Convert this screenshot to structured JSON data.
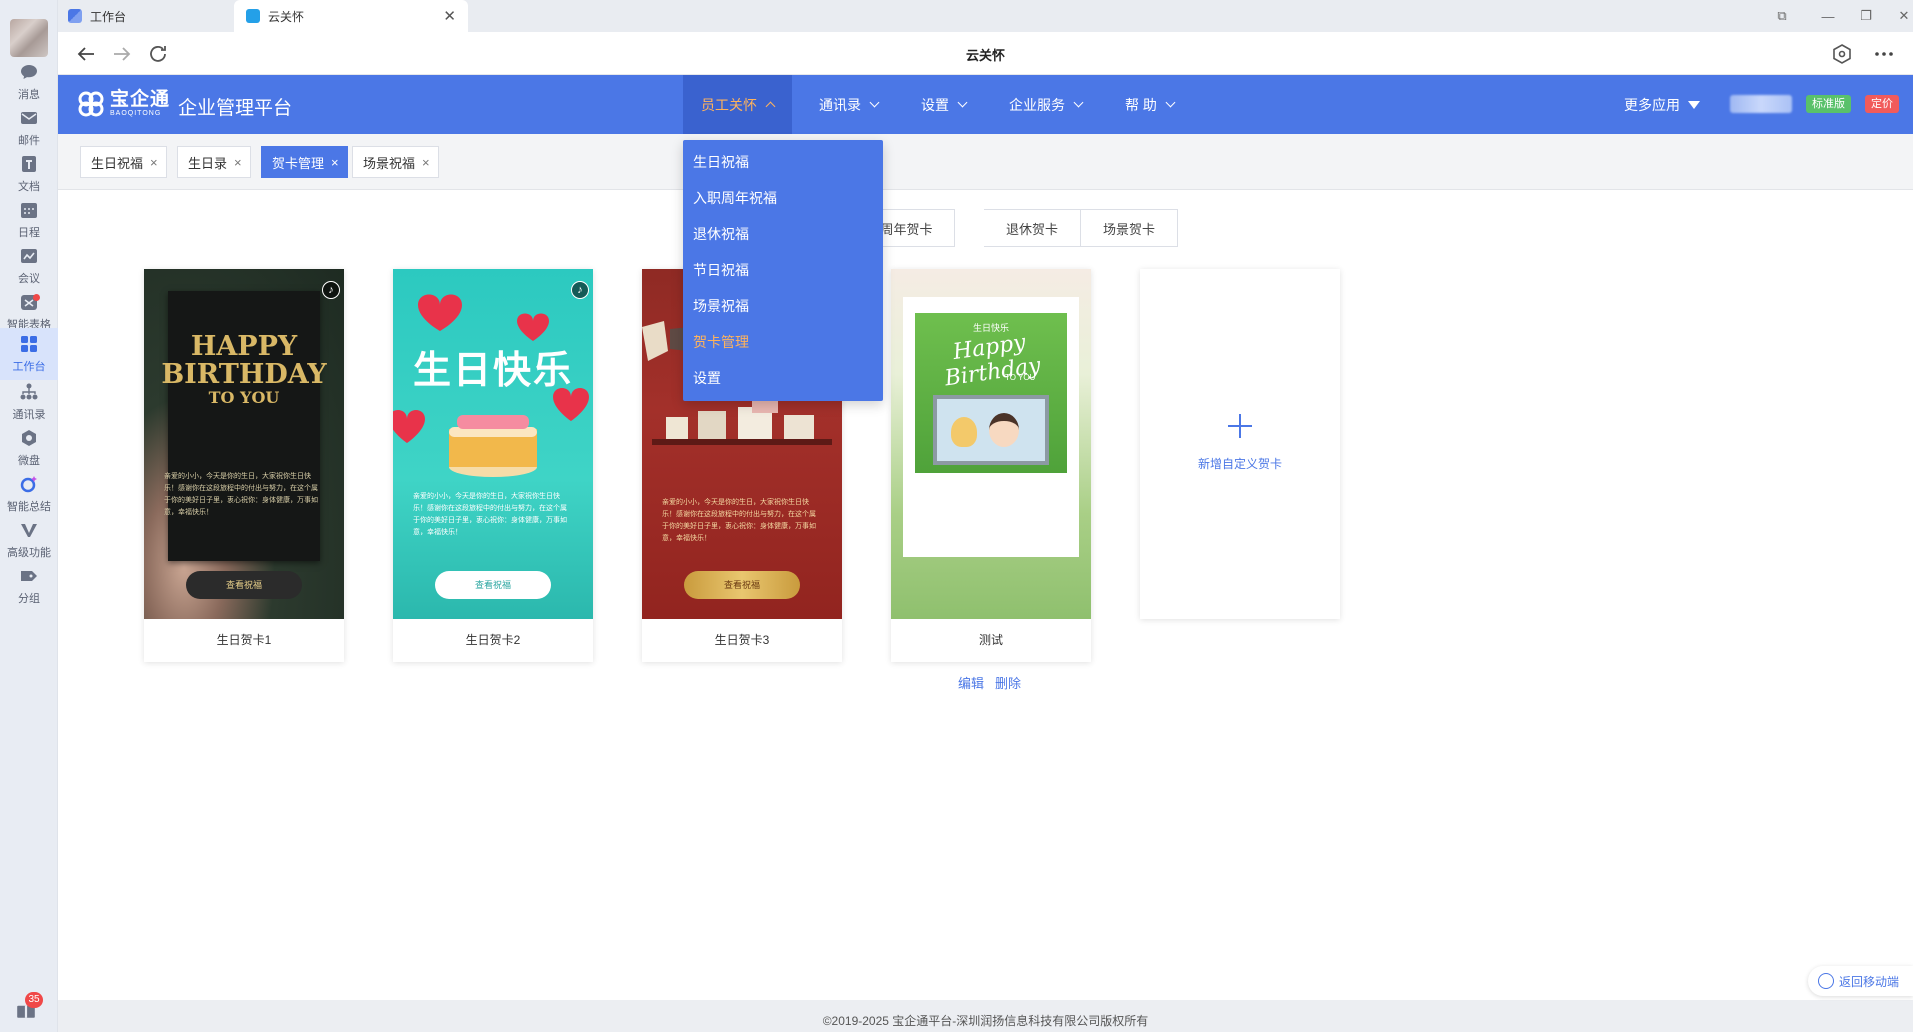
{
  "browser": {
    "tabs": [
      {
        "label": "工作台"
      },
      {
        "label": "云关怀"
      }
    ],
    "title": "云关怀"
  },
  "rail": {
    "items": [
      {
        "label": "消息",
        "icon": "chat-bubble-icon"
      },
      {
        "label": "邮件",
        "icon": "mail-icon"
      },
      {
        "label": "文档",
        "icon": "document-icon"
      },
      {
        "label": "日程",
        "icon": "calendar-icon"
      },
      {
        "label": "会议",
        "icon": "meeting-icon"
      },
      {
        "label": "智能表格",
        "icon": "smart-table-icon"
      },
      {
        "label": "工作台",
        "icon": "workbench-grid-icon"
      },
      {
        "label": "通讯录",
        "icon": "org-chart-icon"
      },
      {
        "label": "微盘",
        "icon": "cloud-drive-icon"
      },
      {
        "label": "智能总结",
        "icon": "ai-summary-icon"
      },
      {
        "label": "高级功能",
        "icon": "advanced-v-icon"
      },
      {
        "label": "分组",
        "icon": "tag-icon"
      }
    ],
    "notification_count": "35"
  },
  "header": {
    "logo_cn": "宝企通",
    "logo_en": "BAOQITONG",
    "platform": "企业管理平台",
    "nav": [
      {
        "label": "员工关怀"
      },
      {
        "label": "通讯录"
      },
      {
        "label": "设置"
      },
      {
        "label": "企业服务"
      },
      {
        "label": "帮 助"
      }
    ],
    "more_apps": "更多应用",
    "edition_badge": "标准版",
    "price_badge": "定价",
    "accent_color": "#4b77e6"
  },
  "dropdown": {
    "items": [
      {
        "label": "生日祝福"
      },
      {
        "label": "入职周年祝福"
      },
      {
        "label": "退休祝福"
      },
      {
        "label": "节日祝福"
      },
      {
        "label": "场景祝福"
      },
      {
        "label": "贺卡管理"
      },
      {
        "label": "设置"
      }
    ]
  },
  "page_tabs": [
    {
      "label": "生日祝福"
    },
    {
      "label": "生日录"
    },
    {
      "label": "贺卡管理"
    },
    {
      "label": "场景祝福"
    }
  ],
  "segments": [
    {
      "label": "周年贺卡"
    },
    {
      "label": "退休贺卡"
    },
    {
      "label": "场景贺卡"
    }
  ],
  "cards": [
    {
      "caption": "生日贺卡1",
      "headline_1": "HAPPY",
      "headline_2": "BIRTHDAY",
      "headline_3": "TO YOU",
      "body": "亲爱的小小，今天是你的生日，大家祝你生日快乐！感谢你在这段旅程中的付出与努力，在这个属于你的美好日子里，衷心祝你：身体健康，万事如意，幸福快乐！",
      "button": "查看祝福"
    },
    {
      "caption": "生日贺卡2",
      "headline": "生日快乐",
      "body": "亲爱的小小，今天是你的生日，大家祝你生日快乐！感谢你在这段旅程中的付出与努力，在这个属于你的美好日子里，衷心祝你：身体健康，万事如意，幸福快乐！",
      "button": "查看祝福"
    },
    {
      "caption": "生日贺卡3",
      "body": "亲爱的小小，今天是你的生日，大家祝你生日快乐！感谢你在这段旅程中的付出与努力，在这个属于你的美好日子里，衷心祝你：身体健康，万事如意，幸福快乐！",
      "button": "查看祝福"
    },
    {
      "caption": "测试",
      "headline": "生日快乐",
      "script": "Happy Birthday",
      "sub": "TO YOU"
    }
  ],
  "add_card_label": "新增自定义贺卡",
  "card_actions": {
    "edit": "编辑",
    "delete": "删除"
  },
  "footer": "©2019-2025 宝企通平台-深圳润扬信息科技有限公司版权所有",
  "back_to_mobile": "返回移动端"
}
